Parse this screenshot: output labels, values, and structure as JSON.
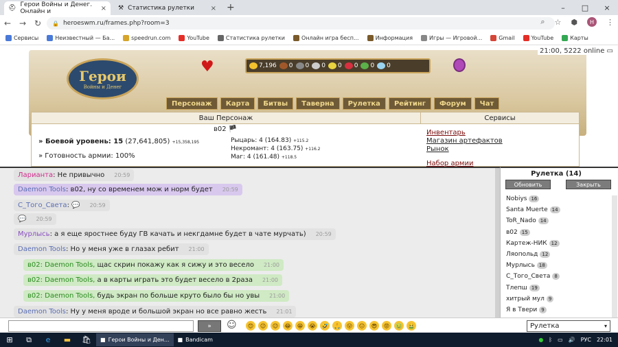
{
  "browser": {
    "tabs": [
      {
        "title": "Герои Войны и Денег. Онлайн и",
        "close": "×"
      },
      {
        "title": "Статистика рулетки",
        "close": "×"
      }
    ],
    "new_tab": "+",
    "url": "heroeswm.ru/frames.php?room=3",
    "win_min": "–",
    "win_max": "□",
    "win_close": "×",
    "profile_initial": "H"
  },
  "bookmarks": [
    {
      "label": "Сервисы",
      "color": "#4a7ad8"
    },
    {
      "label": "Неизвестный — Ба...",
      "color": "#4a7ad8"
    },
    {
      "label": "speedrun.com",
      "color": "#d6a52a"
    },
    {
      "label": "YouTube",
      "color": "#e52d27"
    },
    {
      "label": "Статистика рулетки",
      "color": "#666666"
    },
    {
      "label": "Онлайн игра бесп...",
      "color": "#7a5a2a"
    },
    {
      "label": "Информация",
      "color": "#7a5a2a"
    },
    {
      "label": "Игры — Игровой...",
      "color": "#888888"
    },
    {
      "label": "Gmail",
      "color": "#d44638"
    },
    {
      "label": "YouTube",
      "color": "#e52d27"
    },
    {
      "label": "Карты",
      "color": "#34a853"
    }
  ],
  "game": {
    "logo_title": "Герои",
    "logo_sub": "Войны и Денег",
    "clock": "21:00, 5222 online",
    "resources": [
      {
        "value": "7,196",
        "color": "#f2c12e"
      },
      {
        "value": "0",
        "color": "#a0582a"
      },
      {
        "value": "0",
        "color": "#888888"
      },
      {
        "value": "0",
        "color": "#cccccc"
      },
      {
        "value": "0",
        "color": "#e8d240"
      },
      {
        "value": "0",
        "color": "#d83040"
      },
      {
        "value": "0",
        "color": "#5bb04a"
      },
      {
        "value": "0",
        "color": "#9ad4f0"
      }
    ],
    "menu": [
      "Персонаж",
      "Карта",
      "Битвы",
      "Таверна",
      "Рулетка",
      "Рейтинг",
      "Форум",
      "Чат"
    ],
    "panel_title": "Ваш Персонаж",
    "services_title": "Сервисы",
    "player": "в02",
    "stats": [
      {
        "label": "» Боевой уровень: 15",
        "extra": "(27,641,805)",
        "small": "+15,358,195"
      },
      {
        "label": "» Готовность армии: 100%",
        "extra": "",
        "small": ""
      }
    ],
    "guilds": [
      {
        "label": "Рыцарь: 4",
        "extra": "(164.83)",
        "small": "+115.2"
      },
      {
        "label": "Некромант: 4",
        "extra": "(163.75)",
        "small": "+116.2"
      },
      {
        "label": "Маг: 4",
        "extra": "(161.48)",
        "small": "+118.5"
      }
    ],
    "service_links": [
      "Инвентарь",
      "Магазин артефактов",
      "Рынок",
      "Набор армии"
    ]
  },
  "chat": {
    "messages": [
      {
        "name": "Ларианта",
        "text": ": Не привычно",
        "time": "20:59",
        "style": "grey",
        "nameclass": "pink"
      },
      {
        "name": "Daemon Tools",
        "text": ":  в02, ну со временем мож и норм будет",
        "time": "20:59",
        "style": "purple",
        "nameclass": ""
      },
      {
        "name": "С_Того_Света",
        "text": ":  💬",
        "time": "20:59",
        "style": "grey",
        "nameclass": ""
      },
      {
        "name": "",
        "text": "💬",
        "time": "20:59",
        "style": "grey",
        "nameclass": ""
      },
      {
        "name": "Мурлысь",
        "text": ": а я еще яростнее буду ГВ качать и некгдамне будет в чате мурчать)",
        "time": "20:59",
        "style": "grey",
        "nameclass": "lilac"
      },
      {
        "name": "Daemon Tools",
        "text": ": Но у меня уже в глазах ребит",
        "time": "21:00",
        "style": "grey",
        "nameclass": ""
      },
      {
        "name": "в02:  Daemon Tools,",
        "text": " щас скрин покажу как я сижу и это весело",
        "time": "21:00",
        "style": "green",
        "nameclass": "grn"
      },
      {
        "name": "в02:  Daemon Tools,",
        "text": " а в карты играть это будет весело в 2раза",
        "time": "21:00",
        "style": "green",
        "nameclass": "grn"
      },
      {
        "name": "в02:  Daemon Tools,",
        "text": " будь экран по больше круто было бы но увы",
        "time": "21:00",
        "style": "green",
        "nameclass": "grn"
      },
      {
        "name": "Daemon Tools",
        "text": ": Ну у меня вроде и большой экран но все равно жесть",
        "time": "21:01",
        "style": "grey",
        "nameclass": ""
      }
    ]
  },
  "roulette": {
    "title": "Рулетка (14)",
    "refresh": "Обновить",
    "close": "Закрыть",
    "users": [
      {
        "name": "Nobiys",
        "count": "16"
      },
      {
        "name": "Santa Muerte",
        "count": "14"
      },
      {
        "name": "ToR_Nado",
        "count": "14"
      },
      {
        "name": "в02",
        "count": "15"
      },
      {
        "name": "Картеж-НИК",
        "count": "12"
      },
      {
        "name": "Ляопольд",
        "count": "12"
      },
      {
        "name": "Мурлысь",
        "count": "18"
      },
      {
        "name": "С_Того_Света",
        "count": "8"
      },
      {
        "name": "Тлепш",
        "count": "19"
      },
      {
        "name": "хитрый мул",
        "count": "9"
      },
      {
        "name": "Я в Твери",
        "count": "9"
      }
    ]
  },
  "input": {
    "send": "»",
    "smile": "☺",
    "emojis": [
      "😊",
      "😉",
      "😉",
      "😂",
      "😁",
      "😭",
      "🤣",
      "🙏",
      "😛",
      "😐",
      "😎",
      "😡",
      "🤢",
      "🤮"
    ],
    "channel": "Рулетка",
    "arrow": "▾"
  },
  "taskbar": {
    "apps": [
      {
        "label": "Герои Войны и Ден...",
        "active": true
      },
      {
        "label": "Bandicam",
        "active": false
      }
    ],
    "lang": "РУС",
    "time": "22:01"
  }
}
